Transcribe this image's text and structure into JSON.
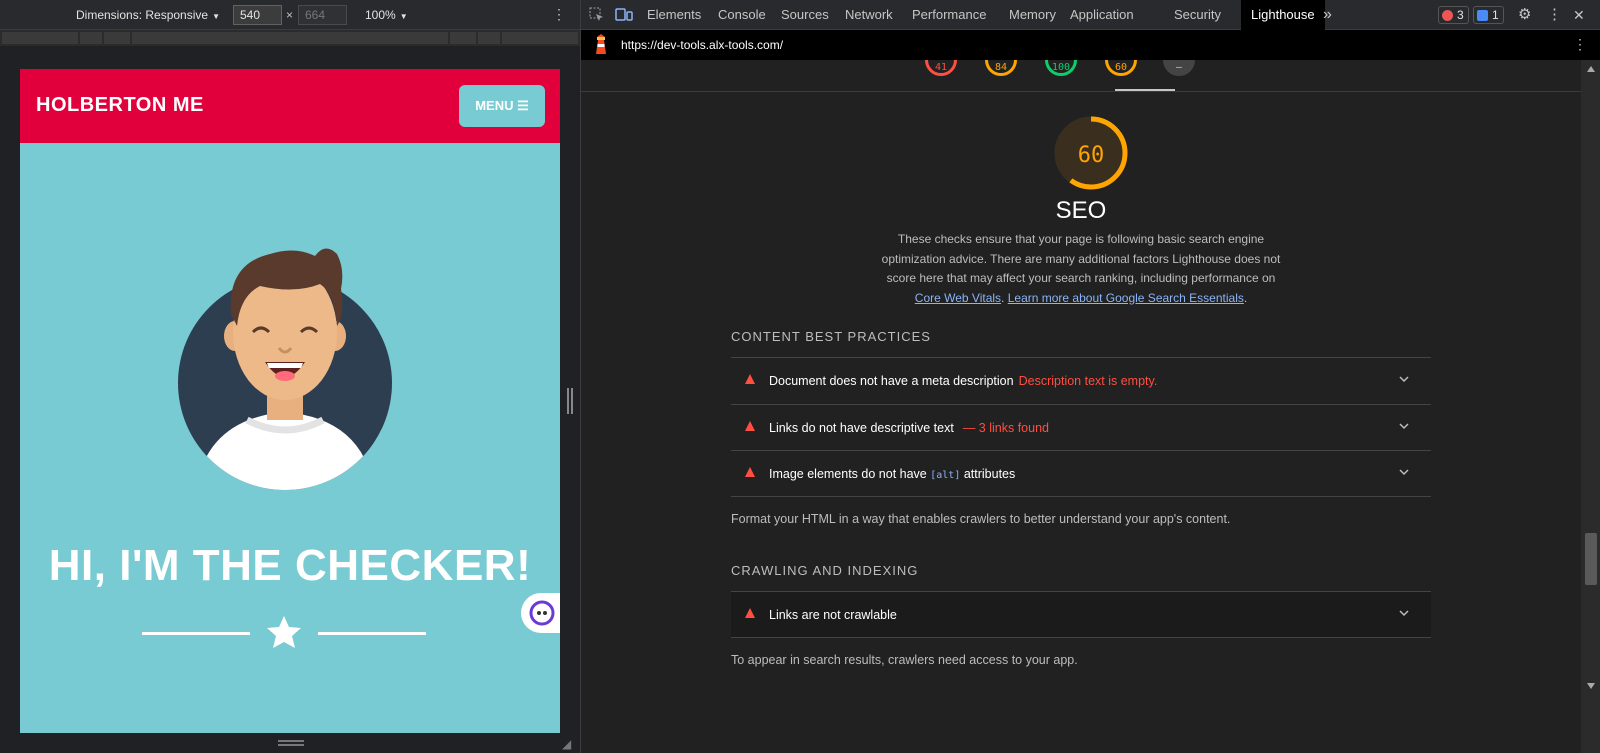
{
  "device_toolbar": {
    "dimensions_label": "Dimensions: Responsive",
    "width": "540",
    "height_placeholder": "664",
    "times": "×",
    "zoom": "100%"
  },
  "page": {
    "brand": "HOLBERTON ME",
    "menu_label": "MENU",
    "menu_icon": "hamburger-icon",
    "hero_title": "HI, I'M THE CHECKER!",
    "divider_icon": "star-icon",
    "colors": {
      "header": "#e1003c",
      "body": "#78cbd2"
    }
  },
  "devtools": {
    "tabs": [
      "Elements",
      "Console",
      "Sources",
      "Network",
      "Performance",
      "Memory",
      "Application",
      "Security",
      "Lighthouse"
    ],
    "active_tab": "Lighthouse",
    "errors_count": "3",
    "messages_count": "1",
    "url": "https://dev-tools.alx-tools.com/"
  },
  "lighthouse": {
    "scores": [
      {
        "value": "41",
        "color": "#ff4e42"
      },
      {
        "value": "84",
        "color": "#ffa400"
      },
      {
        "value": "100",
        "color": "#0cce6b"
      },
      {
        "value": "60",
        "color": "#ffa400"
      },
      {
        "value": "",
        "color": "#9e9e9e"
      }
    ],
    "seo_score": "60",
    "seo_score_fraction": 0.6,
    "seo_title": "SEO",
    "seo_description": "These checks ensure that your page is following basic search engine optimization advice. There are many additional factors Lighthouse does not score here that may affect your search ranking, including performance on",
    "link_core_web_vitals": "Core Web Vitals",
    "link_search_essentials": "Learn more about Google Search Essentials",
    "content_section": {
      "title": "CONTENT BEST PRACTICES",
      "audits": [
        {
          "title": "Document does not have a meta description",
          "detail": "Description text is empty."
        },
        {
          "title": "Links do not have descriptive text",
          "detail": "— 3 links found"
        },
        {
          "title_before": "Image elements do not have",
          "code": "[alt]",
          "title_after": "attributes"
        }
      ],
      "note": "Format your HTML in a way that enables crawlers to better understand your app's content."
    },
    "crawling_section": {
      "title": "CRAWLING AND INDEXING",
      "audits": [
        {
          "title": "Links are not crawlable"
        }
      ],
      "note": "To appear in search results, crawlers need access to your app."
    }
  }
}
